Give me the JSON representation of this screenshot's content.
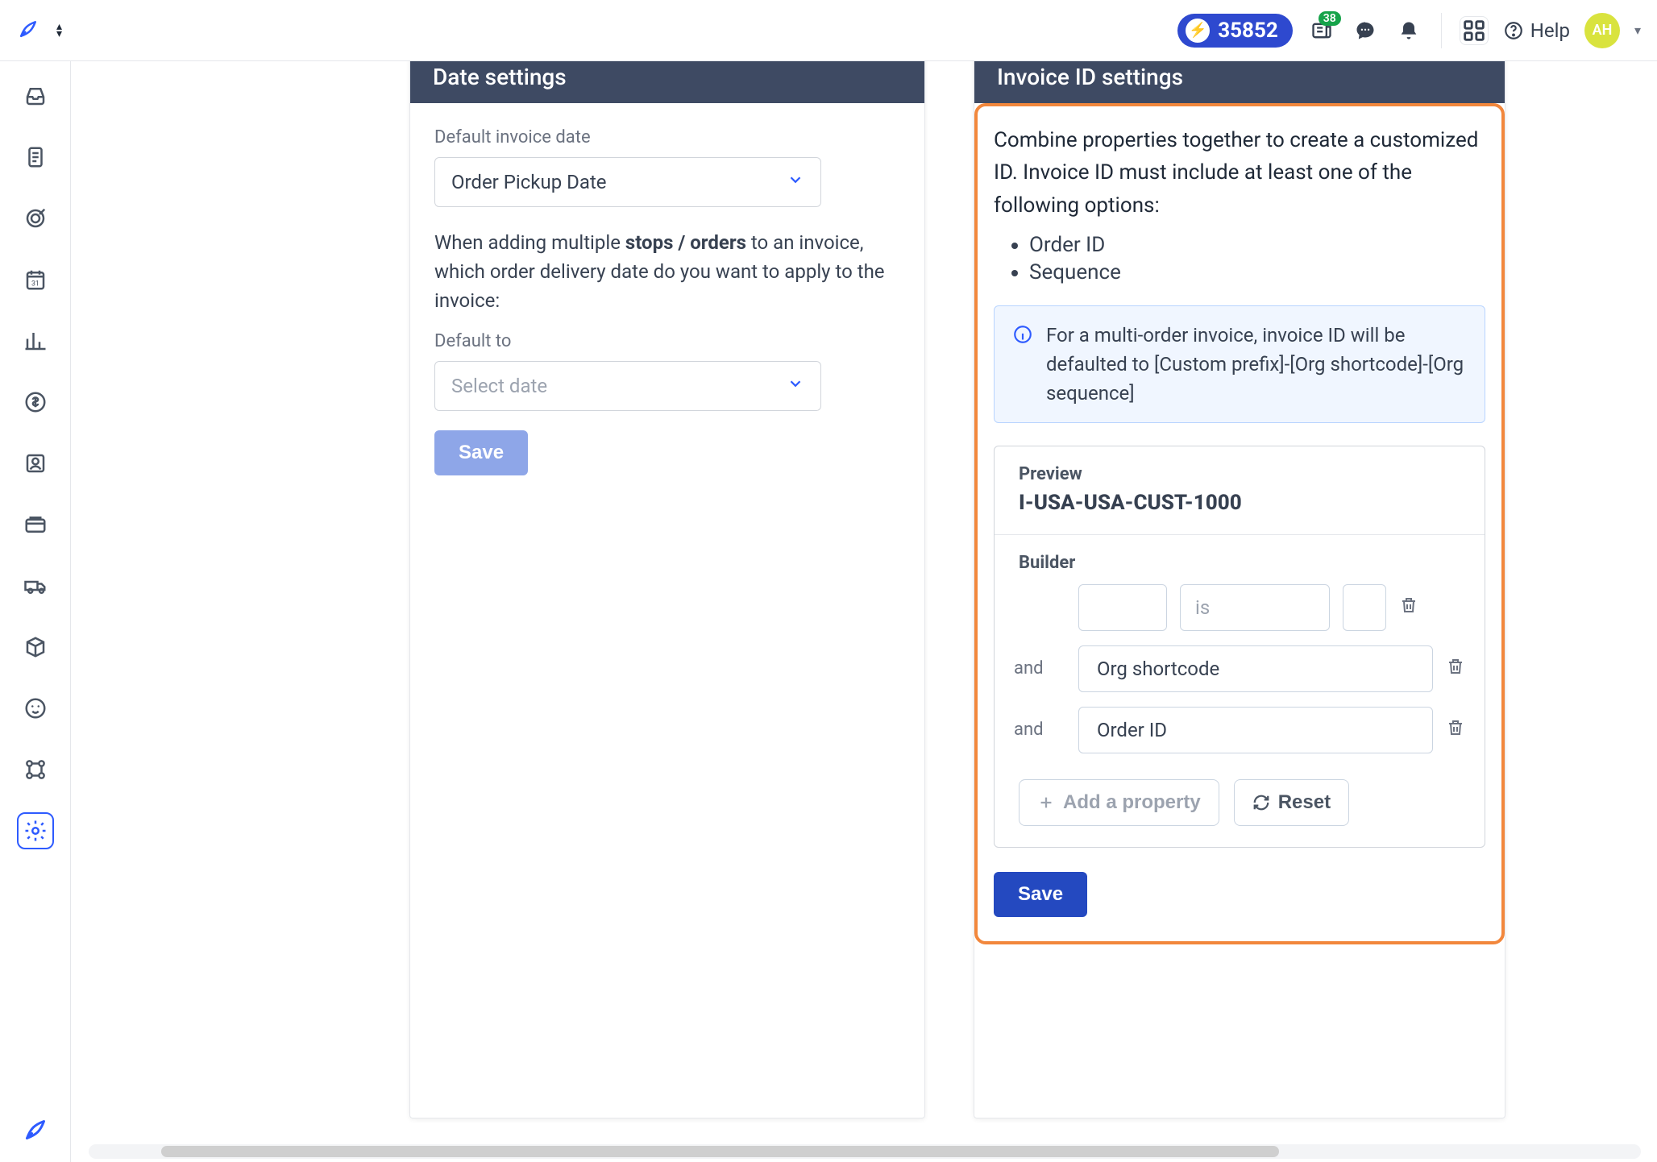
{
  "topbar": {
    "credits": "35852",
    "news_badge": "38",
    "help_label": "Help",
    "avatar_initials": "AH"
  },
  "date_settings": {
    "header": "Date settings",
    "default_invoice_date_label": "Default invoice date",
    "default_invoice_date_value": "Order Pickup Date",
    "multi_para_pre": "When adding multiple ",
    "multi_para_strong": "stops / orders",
    "multi_para_post": " to an invoice, which order delivery date do you want to apply to the invoice:",
    "default_to_label": "Default to",
    "default_to_placeholder": "Select date",
    "save_label": "Save"
  },
  "invoice_id": {
    "header": "Invoice ID settings",
    "description": "Combine properties together to create a customized ID. Invoice ID must include at least one of the following options:",
    "required_options": [
      "Order ID",
      "Sequence"
    ],
    "callout": "For a multi-order invoice, invoice ID will be defaulted to [Custom prefix]-[Org shortcode]-[Org sequence]",
    "preview_label": "Preview",
    "preview_value": "I-USA-USA-CUST-1000",
    "builder_label": "Builder",
    "builder_rows": [
      {
        "connector": "",
        "value1": "",
        "value2_placeholder": "is",
        "value3": ""
      },
      {
        "connector": "and",
        "value": "Org shortcode"
      },
      {
        "connector": "and",
        "value": "Order ID"
      }
    ],
    "add_property_label": "Add a property",
    "reset_label": "Reset",
    "save_label": "Save"
  }
}
